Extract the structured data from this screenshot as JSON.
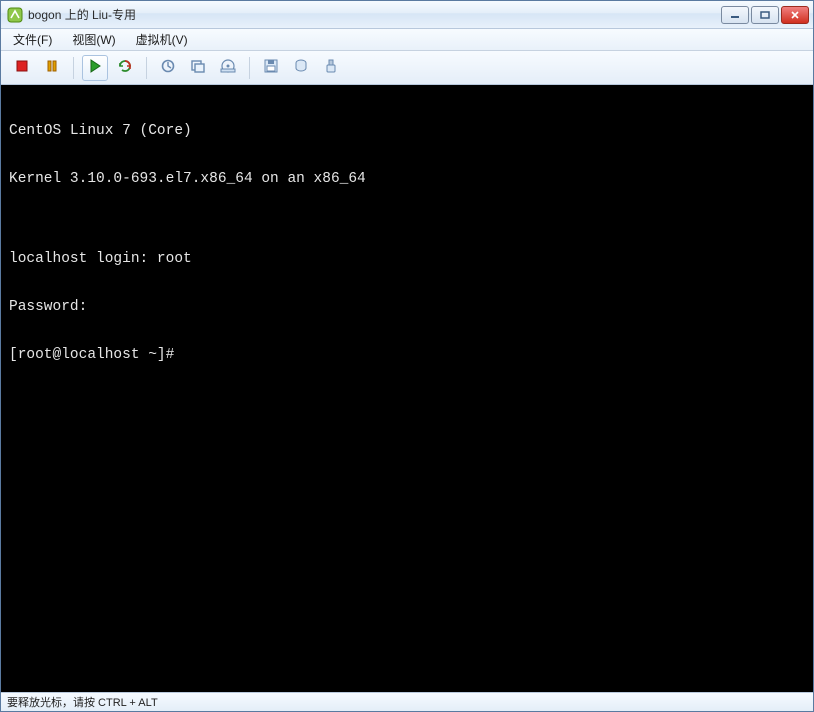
{
  "window": {
    "title": "bogon 上的 Liu-专用"
  },
  "menu": {
    "file": "文件(F)",
    "view": "视图(W)",
    "vm": "虚拟机(V)"
  },
  "toolbar_icons": {
    "stop": "stop-icon",
    "pause": "pause-icon",
    "play": "play-icon",
    "refresh": "refresh-icon",
    "snapshot": "snapshot-icon",
    "snapshot_mgr": "snapshot-manager-icon",
    "cdrom": "cdrom-icon",
    "floppy": "floppy-icon",
    "network": "network-icon",
    "usb": "usb-icon"
  },
  "console": {
    "lines": [
      "CentOS Linux 7 (Core)",
      "Kernel 3.10.0-693.el7.x86_64 on an x86_64",
      "",
      "localhost login: root",
      "Password:",
      "[root@localhost ~]#"
    ]
  },
  "statusbar": {
    "text": "要释放光标，请按 CTRL + ALT"
  }
}
